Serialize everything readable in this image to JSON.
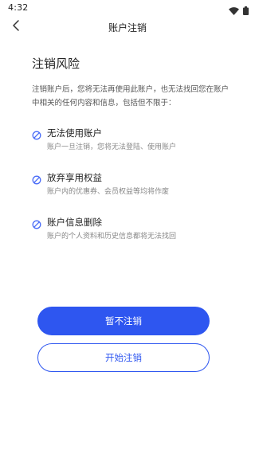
{
  "status_bar": {
    "time": "4:32"
  },
  "header": {
    "title": "账户注销"
  },
  "content": {
    "section_title": "注销风险",
    "intro": "注销账户后，您将无法再使用此账户，也无法找回您在账户中相关的任何内容和信息，包括但不限于：",
    "risks": [
      {
        "title": "无法使用账户",
        "desc": "账户一旦注销，您将无法登陆、使用账户"
      },
      {
        "title": "放弃享用权益",
        "desc": "账户内的优惠券、会员权益等均将作废"
      },
      {
        "title": "账户信息删除",
        "desc": "账户的个人资料和历史信息都将无法找回"
      }
    ]
  },
  "actions": {
    "cancel_label": "暂不注销",
    "confirm_label": "开始注销"
  },
  "colors": {
    "accent": "#2e56f0",
    "risk_icon": "#4a6cf7"
  },
  "icons": {
    "back": "chevron-left-icon",
    "risk": "forbidden-icon",
    "wifi": "wifi-icon",
    "battery": "battery-icon"
  }
}
